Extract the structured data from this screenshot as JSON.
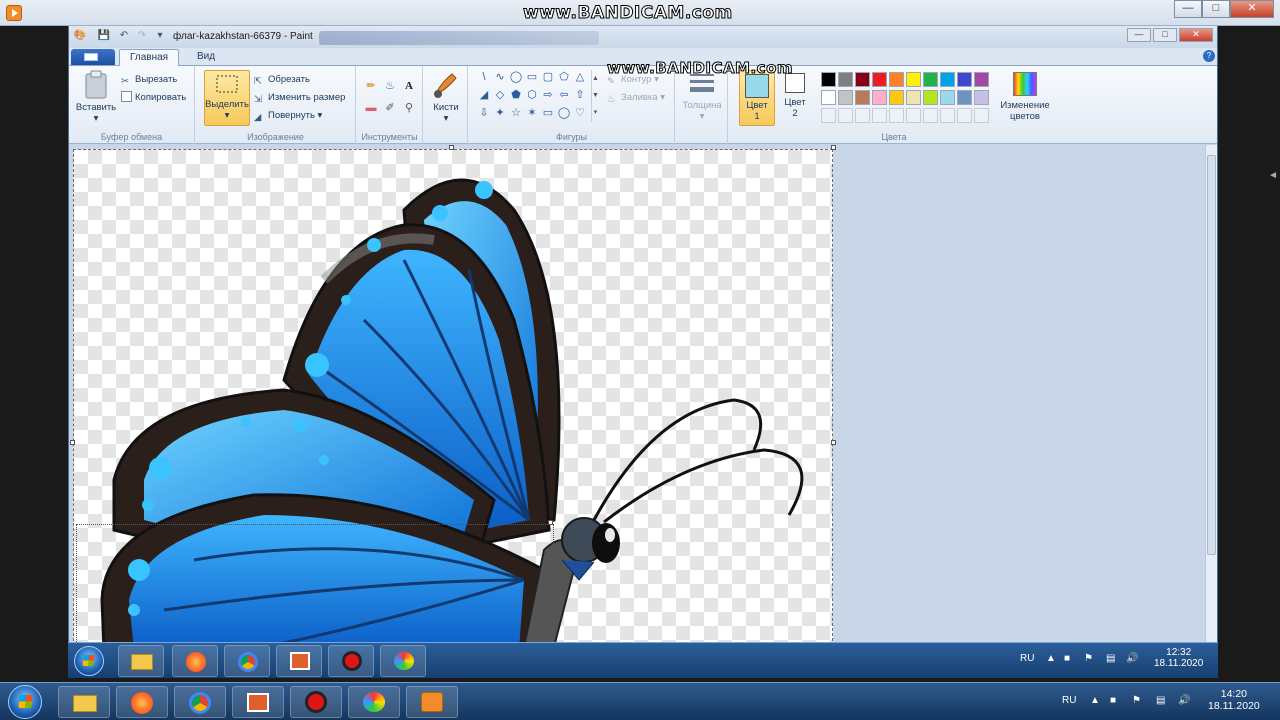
{
  "watermark": {
    "text": "www.BANDICAM.com"
  },
  "paint": {
    "title": "флаг-kazakhstan-66379 - Paint",
    "tabs": {
      "home": "Главная",
      "view": "Вид"
    },
    "clipboard": {
      "paste": "Вставить",
      "cut": "Вырезать",
      "copy": "Копировать",
      "label": "Буфер обмена"
    },
    "image": {
      "select": "Выделить",
      "crop": "Обрезать",
      "resize": "Изменить размер",
      "rotate": "Повернуть",
      "label": "Изображение"
    },
    "tools": {
      "label": "Инструменты",
      "text_tool": "A"
    },
    "brushes": {
      "label": "Кисти"
    },
    "shapes": {
      "label": "Фигуры",
      "outline": "Контур",
      "fill": "Заливка"
    },
    "size": {
      "label": "Толщина"
    },
    "colors": {
      "color1": "Цвет",
      "color1_num": "1",
      "color2": "Цвет",
      "color2_num": "2",
      "edit": "Изменение цветов",
      "label": "Цвета",
      "color1_value": "#99d9ea",
      "color2_value": "#ffffff",
      "palette_row1": [
        "#000000",
        "#7f7f7f",
        "#880015",
        "#ed1c24",
        "#ff7f27",
        "#fff200",
        "#22b14c",
        "#00a2e8",
        "#3f48cc",
        "#a349a4"
      ],
      "palette_row2": [
        "#ffffff",
        "#c3c3c3",
        "#b97a57",
        "#ffaec9",
        "#ffc90e",
        "#efe4b0",
        "#b5e61d",
        "#99d9ea",
        "#7092be",
        "#c8bfe7"
      ]
    }
  },
  "inner_taskbar": {
    "lang": "RU",
    "time": "12:32",
    "date": "18.11.2020"
  },
  "outer_taskbar": {
    "lang": "RU",
    "time": "14:20",
    "date": "18.11.2020"
  }
}
